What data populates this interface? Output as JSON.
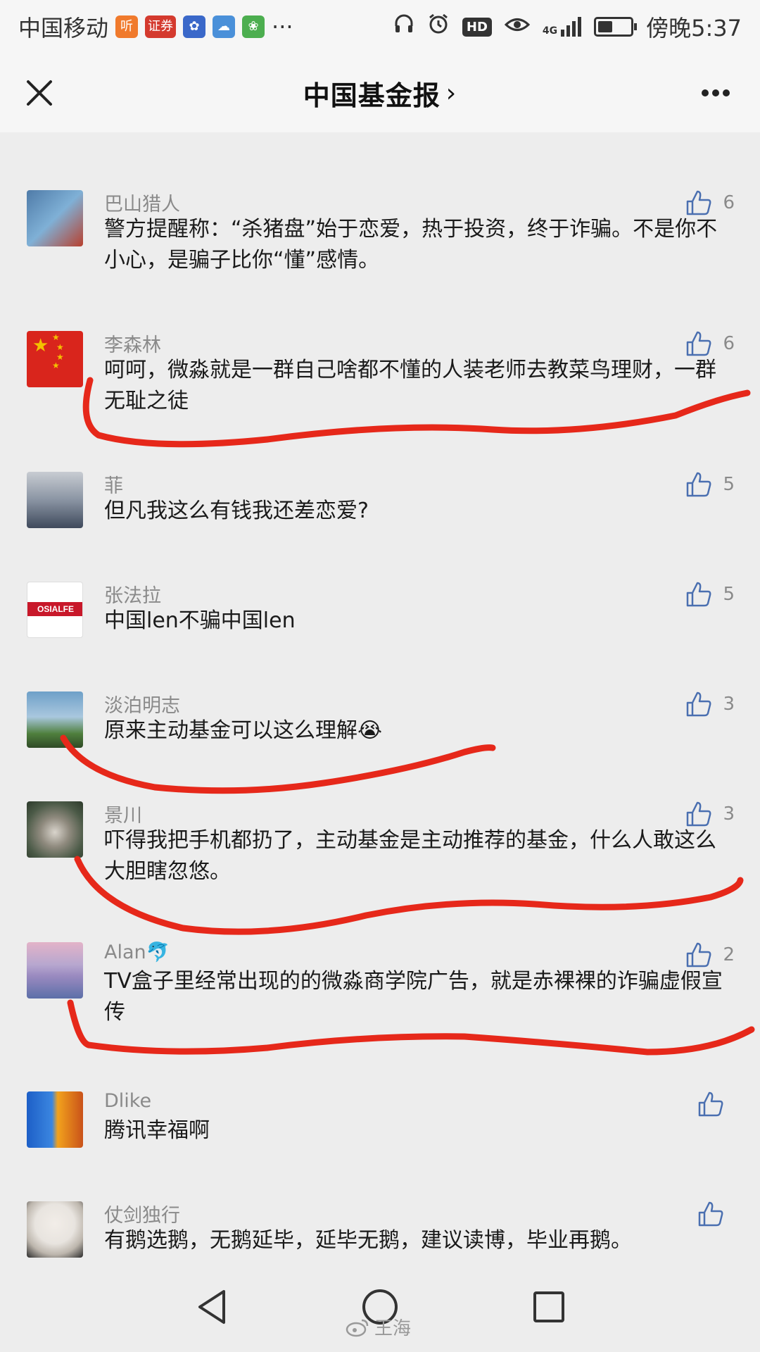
{
  "status_bar": {
    "carrier": "中国移动",
    "apps": [
      {
        "name": "tingting-app-icon",
        "label": "听",
        "color": "#f07a2c"
      },
      {
        "name": "securities-app-icon",
        "label": "证券",
        "color": "#d43a2e"
      },
      {
        "name": "bank-app-icon",
        "label": "",
        "color": "#3a68c9"
      },
      {
        "name": "cloud-app-icon",
        "label": "",
        "color": "#4a90d9"
      },
      {
        "name": "plant-app-icon",
        "label": "",
        "color": "#4cae4f"
      }
    ],
    "more": "···",
    "network": "4G",
    "hd": "HD",
    "time": "傍晚5:37"
  },
  "nav": {
    "title": "中国基金报",
    "chevron": "›"
  },
  "comments": [
    {
      "user": "巴山猎人",
      "text": "警方提醒称：“杀猪盘”始于恋爱，热于投资，终于诈骗。不是你不小心，是骗子比你“懂”感情。",
      "likes": "6",
      "avatar_color": "#4f7ba8",
      "avatar_color2": "#b8402e"
    },
    {
      "user": "李森林",
      "text": "呵呵，微淼就是一群自己啥都不懂的人装老师去教菜鸟理财，一群无耻之徒",
      "likes": "6",
      "avatar_color": "#d9251c",
      "avatar_color2": "#f3c200"
    },
    {
      "user": "菲",
      "text": "但凡我这么有钱我还差恋爱?",
      "likes": "5",
      "avatar_color": "#c8ccd2",
      "avatar_color2": "#3f4a5c"
    },
    {
      "user": "张法拉",
      "text": "中国len不骗中国len",
      "likes": "5",
      "avatar_color": "#ffffff",
      "avatar_color2": "#c8182a",
      "avatar_text": "OSIALFE"
    },
    {
      "user": "淡泊明志",
      "text": "原来主动基金可以这么理解😭",
      "likes": "3",
      "avatar_color": "#6ea0c8",
      "avatar_color2": "#4f7f3d"
    },
    {
      "user": "景川",
      "text": "吓得我把手机都扔了，主动基金是主动推荐的基金，什么人敢这么大胆瞎忽悠。",
      "likes": "3",
      "avatar_color": "#4b5a47",
      "avatar_color2": "#d9d4cc"
    },
    {
      "user": "Alan🐬",
      "text": "TV盒子里经常出现的的微淼商学院广告，就是赤裸裸的诈骗虚假宣传",
      "likes": "2",
      "avatar_color": "#9a8ac0",
      "avatar_color2": "#e3b3c8"
    },
    {
      "user": "Dlike",
      "text": "腾讯幸福啊",
      "likes": "",
      "avatar_color": "#1d5fc7",
      "avatar_color2": "#f2a21c"
    },
    {
      "user": "仗剑独行",
      "text": "有鹅选鹅，无鹅延毕，延毕无鹅，建议读博，毕业再鹅。",
      "likes": "",
      "avatar_color": "#e8e4df",
      "avatar_color2": "#2b2b2b"
    }
  ],
  "bottom_nav": {
    "watermark": "王海"
  },
  "colors": {
    "annotation_red": "#e6281a",
    "background": "#ededed"
  }
}
